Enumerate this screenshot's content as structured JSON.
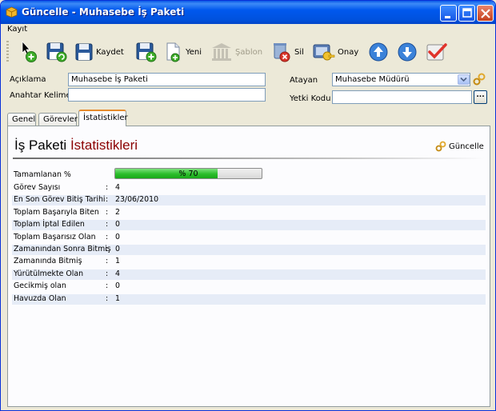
{
  "window": {
    "title": "Güncelle - Muhasebe İş Paketi"
  },
  "menu": {
    "items": [
      "Kayıt"
    ]
  },
  "toolbar": {
    "save_label": "Kaydet",
    "new_label": "Yeni",
    "template_label": "Şablon",
    "delete_label": "Sil",
    "approve_label": "Onay"
  },
  "form": {
    "description_label": "Açıklama",
    "description_value": "Muhasebe İş Paketi",
    "keyword_label": "Anahtar Kelime",
    "keyword_value": "",
    "assigner_label": "Atayan",
    "assigner_value": "Muhasebe Müdürü",
    "authority_label": "Yetki Kodu",
    "authority_value": "",
    "lookup_button": "..."
  },
  "tabs": [
    "Genel",
    "Görevler",
    "İstatistikler"
  ],
  "stats_panel": {
    "title_part1": "İş Paketi",
    "title_part2": "İstatistikleri",
    "refresh_label": "Güncelle",
    "completed_label": "Tamamlanan %",
    "completed_text": "% 70",
    "completed_percent": 70,
    "separator": ":",
    "rows": [
      {
        "label": "Görev Sayısı",
        "value": "4"
      },
      {
        "label": "En Son Görev Bitiş Tarihi",
        "value": "23/06/2010"
      },
      {
        "label": "Toplam Başarıyla Biten",
        "value": "2"
      },
      {
        "label": "Toplam İptal Edilen",
        "value": "0"
      },
      {
        "label": "Toplam Başarısız Olan",
        "value": "0"
      },
      {
        "label": "Zamanından Sonra Bitmiş",
        "value": "0"
      },
      {
        "label": "Zamanında Bitmiş",
        "value": "1"
      },
      {
        "label": "Yürütülmekte Olan",
        "value": "4"
      },
      {
        "label": "Gecikmiş olan",
        "value": "0"
      },
      {
        "label": "Havuzda Olan",
        "value": "1"
      }
    ]
  },
  "colors": {
    "titlebar": "#0058ee",
    "title_accent": "#8b0000",
    "progress_fill": "#2bbd2b",
    "alt_row": "#e6ecf7"
  }
}
